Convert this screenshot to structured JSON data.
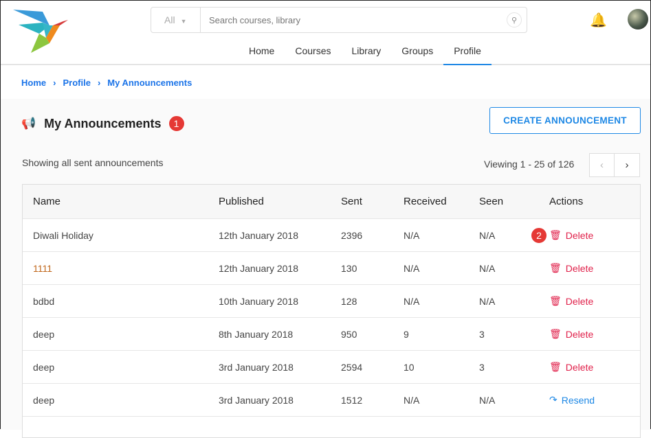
{
  "header": {
    "search_scope": "All",
    "search_placeholder": "Search courses, library",
    "nav": [
      "Home",
      "Courses",
      "Library",
      "Groups",
      "Profile"
    ],
    "active_nav": "Profile"
  },
  "breadcrumb": [
    "Home",
    "Profile",
    "My Announcements"
  ],
  "page": {
    "title": "My Announcements",
    "badge1": "1",
    "badge2": "2",
    "create_label": "CREATE ANNOUNCEMENT",
    "showing": "Showing all sent announcements",
    "viewing": "Viewing 1 - 25 of 126"
  },
  "table": {
    "columns": [
      "Name",
      "Published",
      "Sent",
      "Received",
      "Seen",
      "Actions"
    ],
    "rows": [
      {
        "name": "Diwali Holiday",
        "published": "12th January 2018",
        "sent": "2396",
        "received": "N/A",
        "seen": "N/A",
        "action": "Delete"
      },
      {
        "name": "1111",
        "published": "12th January 2018",
        "sent": "130",
        "received": "N/A",
        "seen": "N/A",
        "action": "Delete"
      },
      {
        "name": "bdbd",
        "published": "10th January 2018",
        "sent": "128",
        "received": "N/A",
        "seen": "N/A",
        "action": "Delete"
      },
      {
        "name": "deep",
        "published": "8th January 2018",
        "sent": "950",
        "received": "9",
        "seen": "3",
        "action": "Delete"
      },
      {
        "name": "deep",
        "published": "3rd January 2018",
        "sent": "2594",
        "received": "10",
        "seen": "3",
        "action": "Delete"
      },
      {
        "name": "deep",
        "published": "3rd January 2018",
        "sent": "1512",
        "received": "N/A",
        "seen": "N/A",
        "action": "Resend"
      }
    ]
  }
}
